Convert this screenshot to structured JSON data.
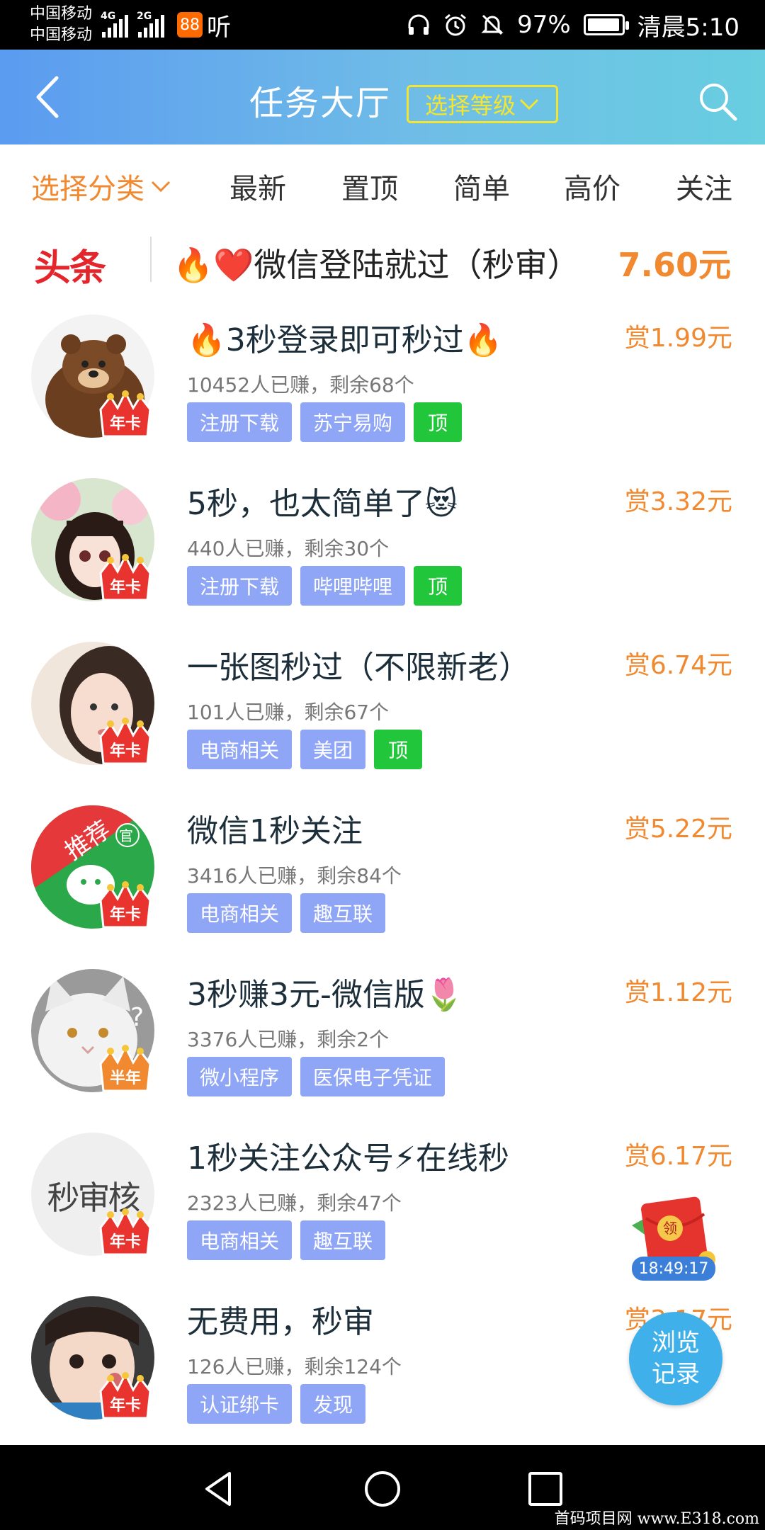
{
  "status": {
    "carrier_1": "中国移动",
    "carrier_2": "中国移动",
    "net_1": "4G",
    "net_2": "2G",
    "app_badge": "88",
    "app_text": "听",
    "battery": "97%",
    "battery_level": 0.97,
    "time": "清晨5:10",
    "icons": [
      "headphone-icon",
      "alarm-icon",
      "mute-icon",
      "battery-icon"
    ]
  },
  "header": {
    "title": "任务大厅",
    "level_button": "选择等级",
    "icons": [
      "back-icon",
      "search-icon"
    ]
  },
  "categories": {
    "items": [
      "选择分类",
      "最新",
      "置顶",
      "简单",
      "高价",
      "关注"
    ]
  },
  "headline": {
    "logo": "头条",
    "title": "🔥❤️微信登陆就过（秒审）",
    "price": "7.60元"
  },
  "tasks": [
    {
      "title": "🔥3秒登录即可秒过🔥",
      "stats": "10452人已赚，剩余68个",
      "reward": "赏1.99元",
      "badge": "年卡",
      "tags": [
        "注册下载",
        "苏宁易购"
      ],
      "top": "顶"
    },
    {
      "title": "5秒，也太简单了😻",
      "stats": "440人已赚，剩余30个",
      "reward": "赏3.32元",
      "badge": "年卡",
      "tags": [
        "注册下载",
        "哔哩哔哩"
      ],
      "top": "顶"
    },
    {
      "title": "一张图秒过（不限新老）",
      "stats": "101人已赚，剩余67个",
      "reward": "赏6.74元",
      "badge": "年卡",
      "tags": [
        "电商相关",
        "美团"
      ],
      "top": "顶"
    },
    {
      "title": "微信1秒关注",
      "stats": "3416人已赚，剩余84个",
      "reward": "赏5.22元",
      "badge": "年卡",
      "tags": [
        "电商相关",
        "趣互联"
      ],
      "top": "",
      "avatar_text": "推荐",
      "avatar_sub": "官"
    },
    {
      "title": "3秒赚3元-微信版🌷",
      "stats": "3376人已赚，剩余2个",
      "reward": "赏1.12元",
      "badge": "半年",
      "tags": [
        "微小程序",
        "医保电子凭证"
      ],
      "top": ""
    },
    {
      "title": "1秒关注公众号⚡在线秒",
      "stats": "2323人已赚，剩余47个",
      "reward": "赏6.17元",
      "badge": "年卡",
      "tags": [
        "电商相关",
        "趣互联"
      ],
      "top": "",
      "avatar_text": "秒审核"
    },
    {
      "title": "无费用，秒审",
      "stats": "126人已赚，剩余124个",
      "reward": "赏3.17元",
      "badge": "年卡",
      "tags": [
        "认证绑卡",
        "发现"
      ],
      "top": ""
    }
  ],
  "floating": {
    "red_packet_text": "领",
    "timer": "18:49:17",
    "history_line1": "浏览",
    "history_line2": "记录"
  },
  "nav": {
    "icons": [
      "back-triangle-icon",
      "home-circle-icon",
      "recent-square-icon"
    ],
    "watermark": "首码项目网 www.E318.com"
  },
  "colors": {
    "accent_orange": "#f0892f",
    "tag_blue": "#8fa5f5",
    "tag_green": "#22c63a",
    "header_start": "#5b9bf0",
    "header_end": "#68cee0",
    "level_yellow": "#f5e52f"
  }
}
